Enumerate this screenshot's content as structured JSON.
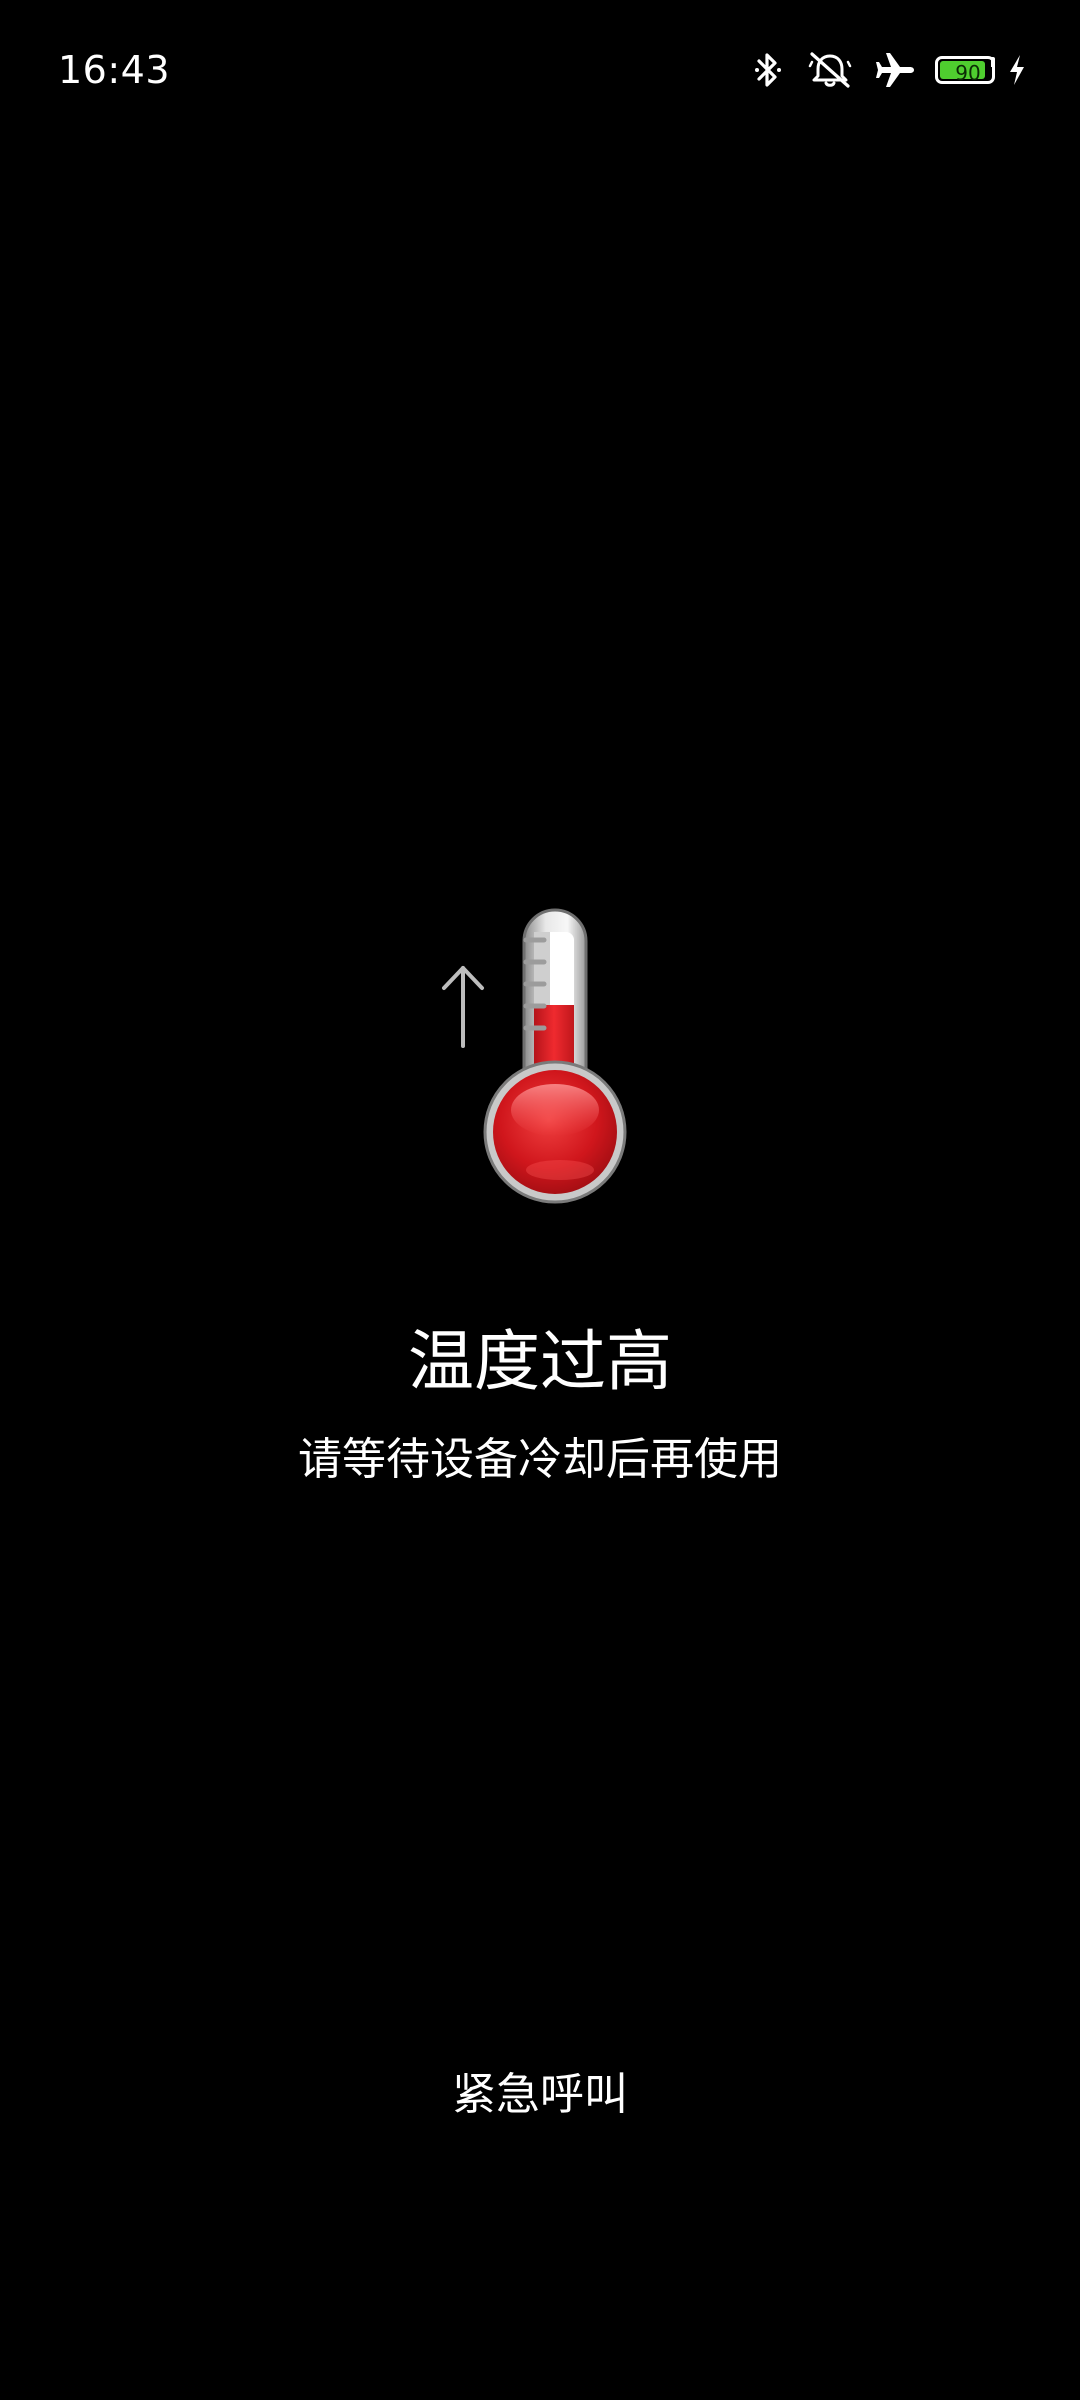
{
  "status_bar": {
    "time": "16:43",
    "battery_level": "90",
    "battery_fraction": 0.9,
    "icons": [
      "bluetooth-icon",
      "mute-icon",
      "airplane-mode-icon",
      "battery-icon",
      "charging-icon"
    ],
    "battery_color": "#4fce2f"
  },
  "warning": {
    "icon": "thermometer-icon",
    "indicator": "up-arrow-icon",
    "accent_color": "#e01f26",
    "title": "温度过高",
    "message": "请等待设备冷却后再使用"
  },
  "emergency_call": {
    "label": "紧急呼叫"
  }
}
